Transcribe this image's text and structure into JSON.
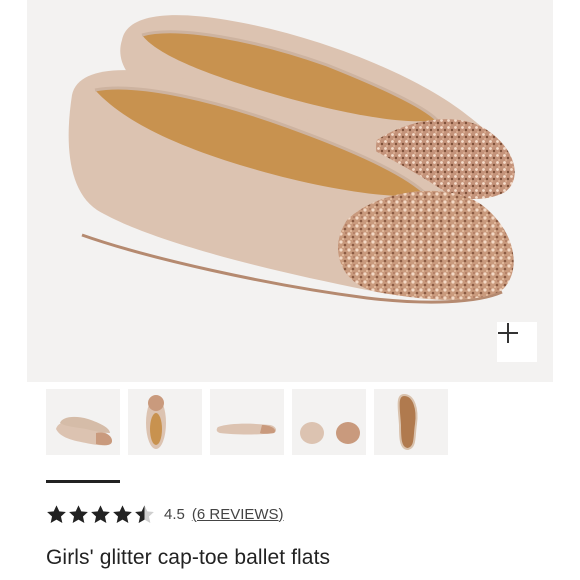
{
  "product": {
    "title": "Girls' glitter cap-toe ballet flats",
    "image_alt": "Rose gold glitter cap-toe ballet flats"
  },
  "gallery": {
    "zoom_icon": "plus-icon",
    "thumbnails": [
      {
        "label": "pair side view",
        "selected": true
      },
      {
        "label": "top view"
      },
      {
        "label": "side profile"
      },
      {
        "label": "front and back view"
      },
      {
        "label": "sole view"
      }
    ]
  },
  "rating": {
    "stars": 4.5,
    "max_stars": 5,
    "value_text": "4.5",
    "reviews_text": "(6 REVIEWS)"
  },
  "colors": {
    "suede": "#dcc3b1",
    "glitter": "#c99a7d",
    "insole": "#c8924f",
    "background": "#f3f2f1"
  }
}
